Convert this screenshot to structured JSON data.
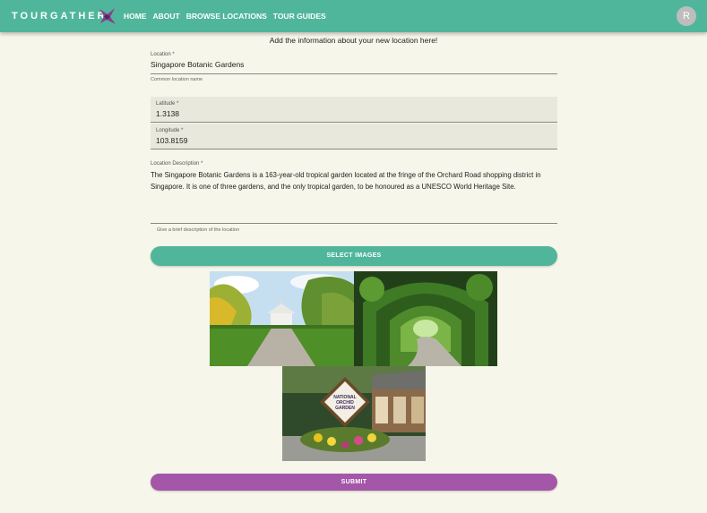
{
  "header": {
    "brand": "TOURGATHER",
    "nav": [
      "HOME",
      "ABOUT",
      "BROWSE LOCATIONS",
      "TOUR GUIDES"
    ],
    "avatar_initial": "R"
  },
  "intro": "Add the information about your new location here!",
  "form": {
    "location": {
      "label": "Location *",
      "value": "Singapore Botanic Gardens",
      "helper": "Common location name"
    },
    "latitude": {
      "label": "Latitude *",
      "value": "1.3138"
    },
    "longitude": {
      "label": "Longitude *",
      "value": "103.8159"
    },
    "description": {
      "label": "Location Description *",
      "value": "The Singapore Botanic Gardens is a 163-year-old tropical garden located at the fringe of the Orchard Road shopping district in Singapore. It is one of three gardens, and the only tropical garden, to be honoured as a UNESCO World Heritage Site.",
      "helper": "Give a brief description of the location"
    }
  },
  "buttons": {
    "select_images": "SELECT IMAGES",
    "submit": "SUBMIT"
  },
  "images": [
    {
      "name": "gazebo-garden-photo"
    },
    {
      "name": "vine-arch-path-photo"
    },
    {
      "name": "national-orchid-garden-sign-photo",
      "sign_lines": [
        "NATIONAL",
        "ORCHID",
        "GARDEN"
      ]
    }
  ],
  "colors": {
    "appbar": "#50b69b",
    "select_button": "#50b69b",
    "submit_button": "#a456a8",
    "background": "#f7f6ea"
  }
}
